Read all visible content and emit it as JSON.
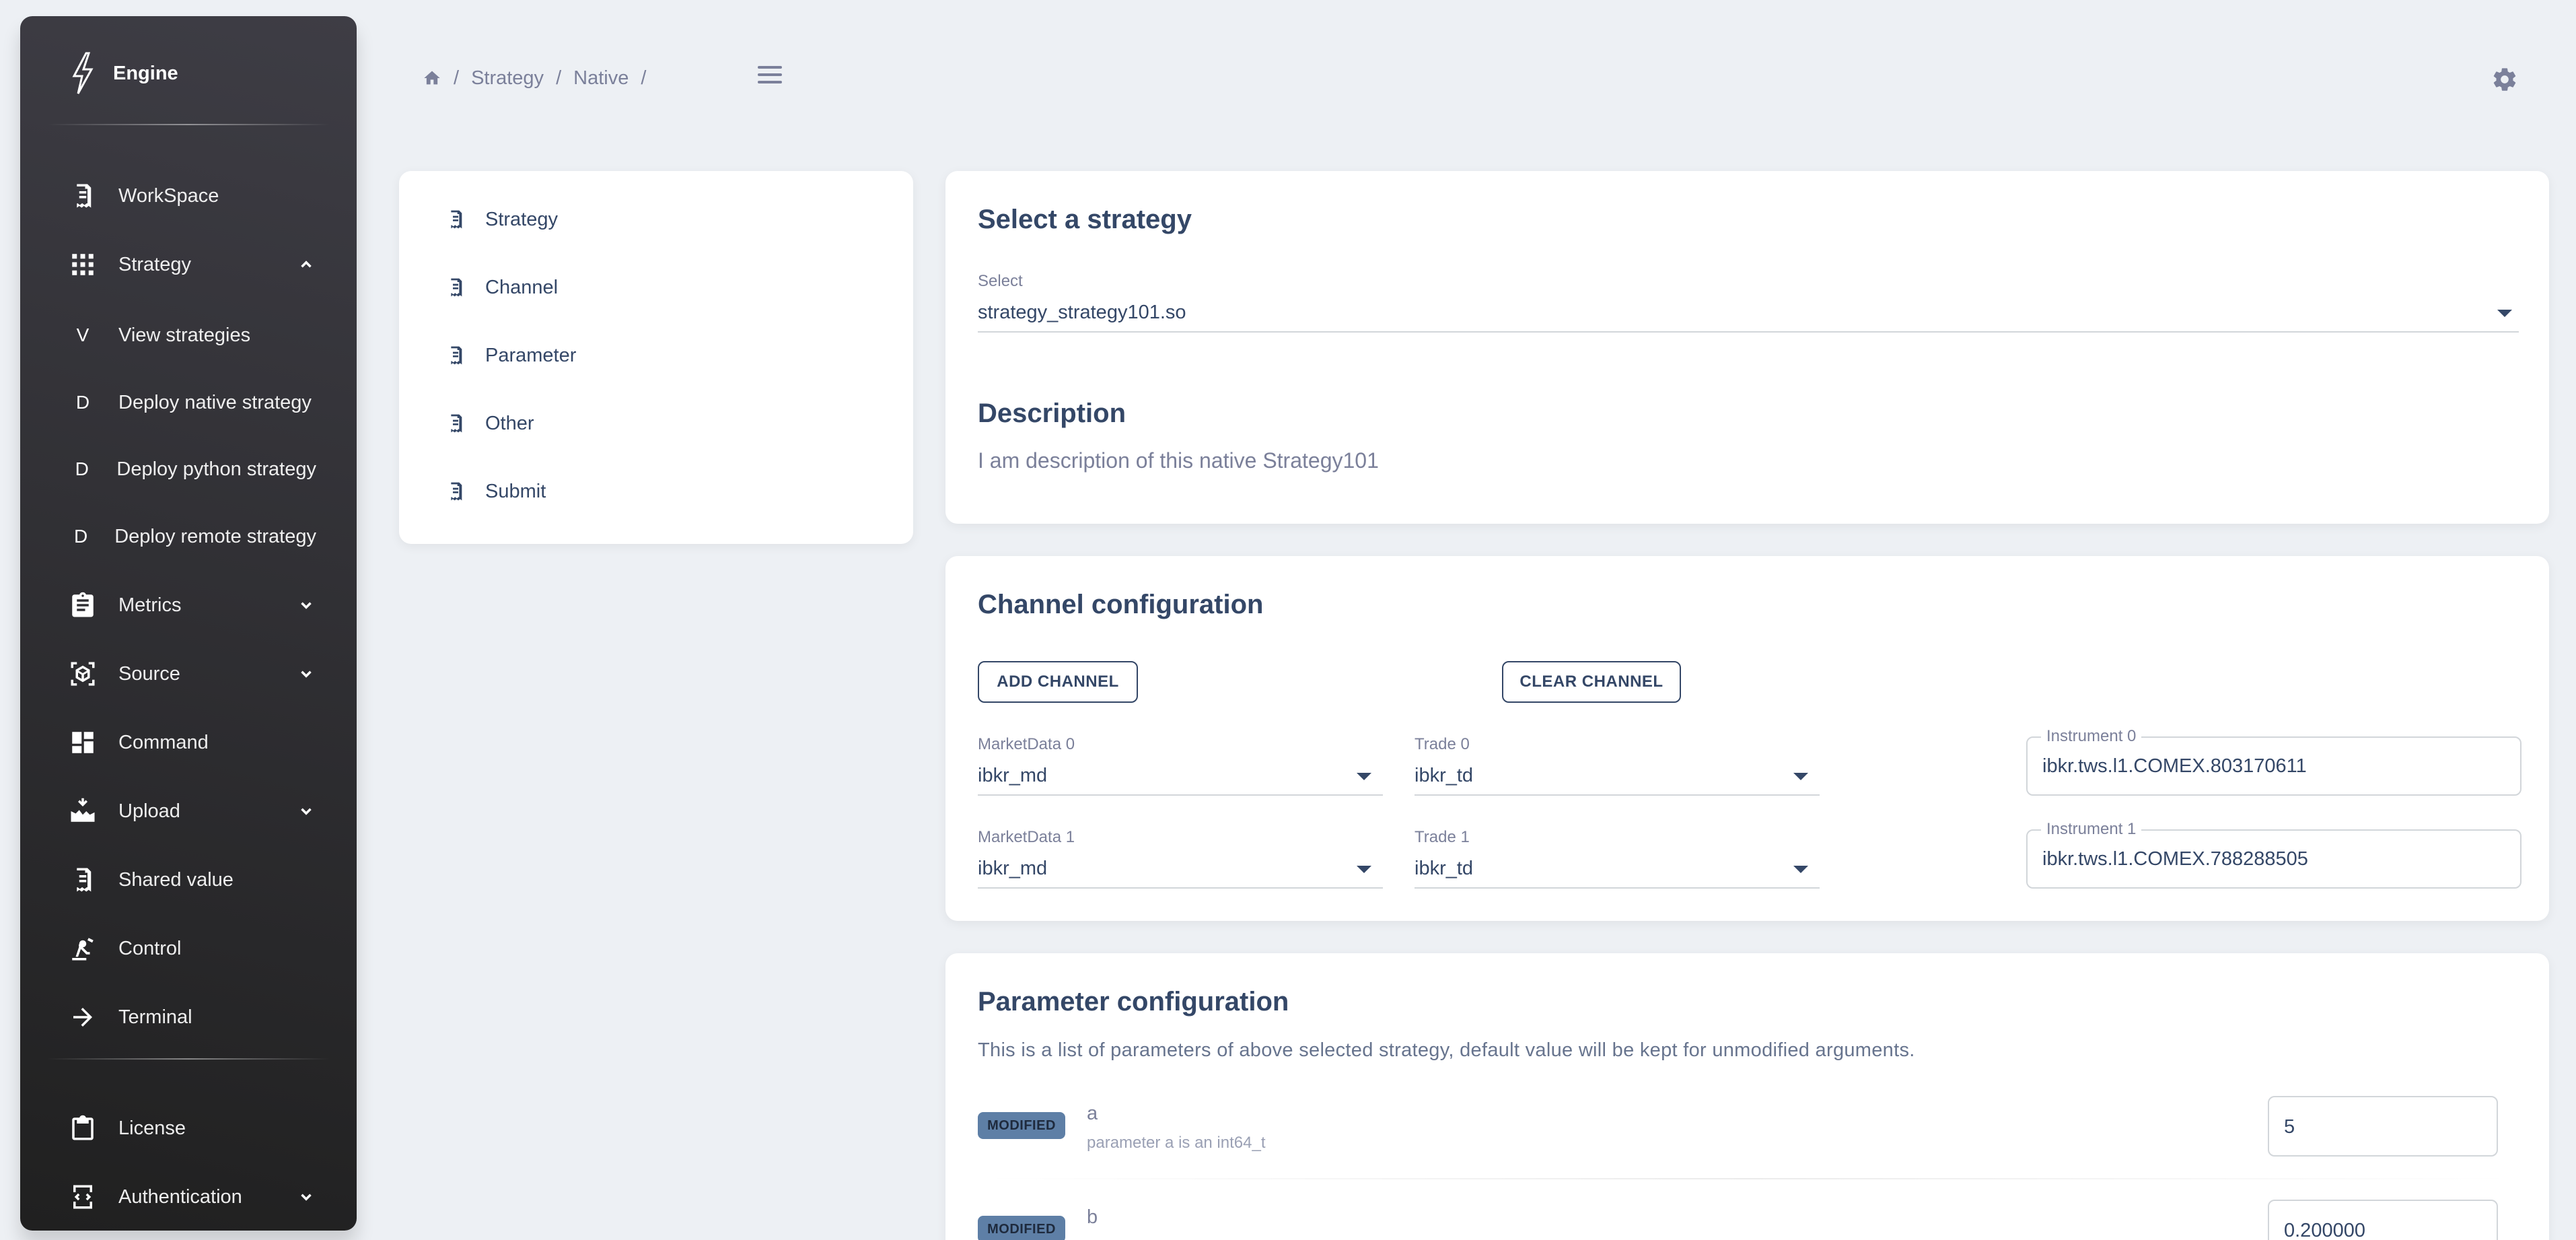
{
  "brand": {
    "name": "Engine"
  },
  "sidebar": {
    "items": [
      {
        "label": "WorkSpace",
        "icon": "receipt-icon"
      },
      {
        "label": "Strategy",
        "icon": "apps-grid-icon",
        "expanded": true
      },
      {
        "label": "View strategies",
        "letter": "V"
      },
      {
        "label": "Deploy native strategy",
        "letter": "D"
      },
      {
        "label": "Deploy python strategy",
        "letter": "D"
      },
      {
        "label": "Deploy remote strategy",
        "letter": "D"
      },
      {
        "label": "Metrics",
        "icon": "clipboard-icon"
      },
      {
        "label": "Source",
        "icon": "cube-scan-icon"
      },
      {
        "label": "Command",
        "icon": "dashboard-icon"
      },
      {
        "label": "Upload",
        "icon": "upload-icon"
      },
      {
        "label": "Shared value",
        "icon": "receipt-icon"
      },
      {
        "label": "Control",
        "icon": "robot-arm-icon"
      },
      {
        "label": "Terminal",
        "icon": "arrow-right-icon"
      },
      {
        "label": "License",
        "icon": "clipboard-icon"
      },
      {
        "label": "Authentication",
        "icon": "code-bracket-icon"
      }
    ]
  },
  "breadcrumb": {
    "items": [
      "Strategy",
      "Native"
    ]
  },
  "steps": [
    "Strategy",
    "Channel",
    "Parameter",
    "Other",
    "Submit"
  ],
  "select_card": {
    "title": "Select a strategy",
    "select_label": "Select",
    "select_value": "strategy_strategy101.so",
    "desc_title": "Description",
    "desc_text": "I am description of this native Strategy101"
  },
  "channel_card": {
    "title": "Channel configuration",
    "add_label": "ADD CHANNEL",
    "clear_label": "CLEAR CHANNEL",
    "rows": [
      {
        "md_label": "MarketData 0",
        "md_value": "ibkr_md",
        "trade_label": "Trade 0",
        "trade_value": "ibkr_td",
        "inst_label": "Instrument 0",
        "inst_value": "ibkr.tws.l1.COMEX.803170611"
      },
      {
        "md_label": "MarketData 1",
        "md_value": "ibkr_md",
        "trade_label": "Trade 1",
        "trade_value": "ibkr_td",
        "inst_label": "Instrument 1",
        "inst_value": "ibkr.tws.l1.COMEX.788288505"
      }
    ]
  },
  "param_card": {
    "title": "Parameter configuration",
    "subtitle": "This is a list of parameters of above selected strategy, default value will be kept for unmodified arguments.",
    "params": [
      {
        "badge": "MODIFIED",
        "name": "a",
        "desc": "parameter a is an int64_t",
        "value": "5"
      },
      {
        "badge": "MODIFIED",
        "name": "b",
        "value": "0.200000"
      }
    ]
  },
  "colors": {
    "sidebar_bg": "#202020",
    "page_bg": "#edf0f4",
    "text_primary": "#344767",
    "text_secondary": "#7b809a",
    "badge_bg": "#5e7fa6"
  }
}
